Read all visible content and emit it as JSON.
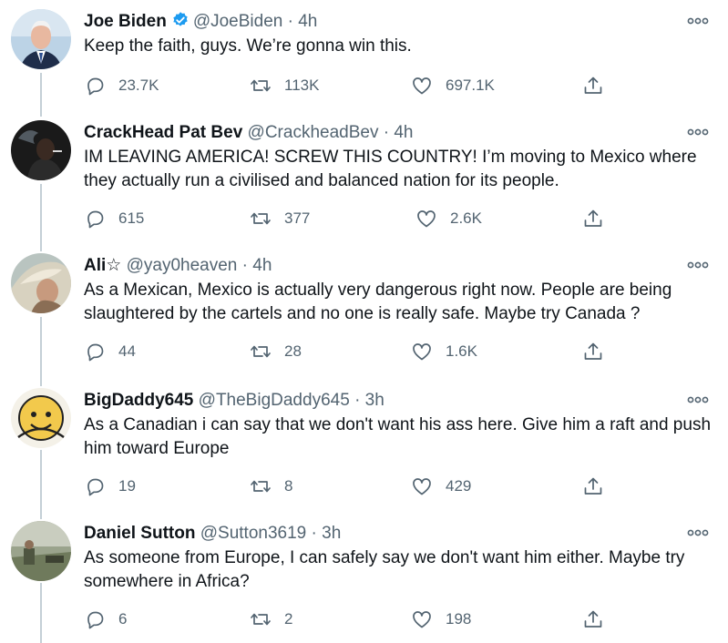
{
  "tweets": [
    {
      "name": "Joe Biden",
      "verified": true,
      "handle": "@JoeBiden",
      "time": "4h",
      "text": "Keep the faith, guys. We’re gonna win this.",
      "replies": "23.7K",
      "retweets": "113K",
      "likes": "697.1K"
    },
    {
      "name": "CrackHead Pat Bev",
      "handle": "@CrackheadBev",
      "time": "4h",
      "text": "IM LEAVING AMERICA! SCREW THIS COUNTRY! I’m moving to Mexico where they actually run a civilised and balanced nation for its people.",
      "replies": "615",
      "retweets": "377",
      "likes": "2.6K"
    },
    {
      "name": "Ali☆",
      "handle": "@yay0heaven",
      "time": "4h",
      "text": "As a Mexican, Mexico is actually very dangerous right now. People are being slaughtered by the cartels and no one is really safe. Maybe try Canada ?",
      "replies": "44",
      "retweets": "28",
      "likes": "1.6K"
    },
    {
      "name": "BigDaddy645",
      "handle": "@TheBigDaddy645",
      "time": "3h",
      "text": "As a Canadian i can say that we don't want his ass here. Give him a raft and push him toward Europe",
      "replies": "19",
      "retweets": "8",
      "likes": "429"
    },
    {
      "name": "Daniel Sutton",
      "handle": "@Sutton3619",
      "time": "3h",
      "text": "As someone from Europe, I can safely say we don't want him either. Maybe try somewhere in Africa?",
      "replies": "6",
      "retweets": "2",
      "likes": "198"
    }
  ],
  "separator": "·",
  "icons": {
    "reply": "reply-icon",
    "retweet": "retweet-icon",
    "like": "heart-icon",
    "share": "share-icon",
    "more": "more-options-icon",
    "verified": "verified-badge-icon"
  },
  "colors": {
    "text": "#0f1419",
    "muted": "#536471",
    "verified": "#1d9bf0",
    "thread_line": "#c4cfd6"
  }
}
